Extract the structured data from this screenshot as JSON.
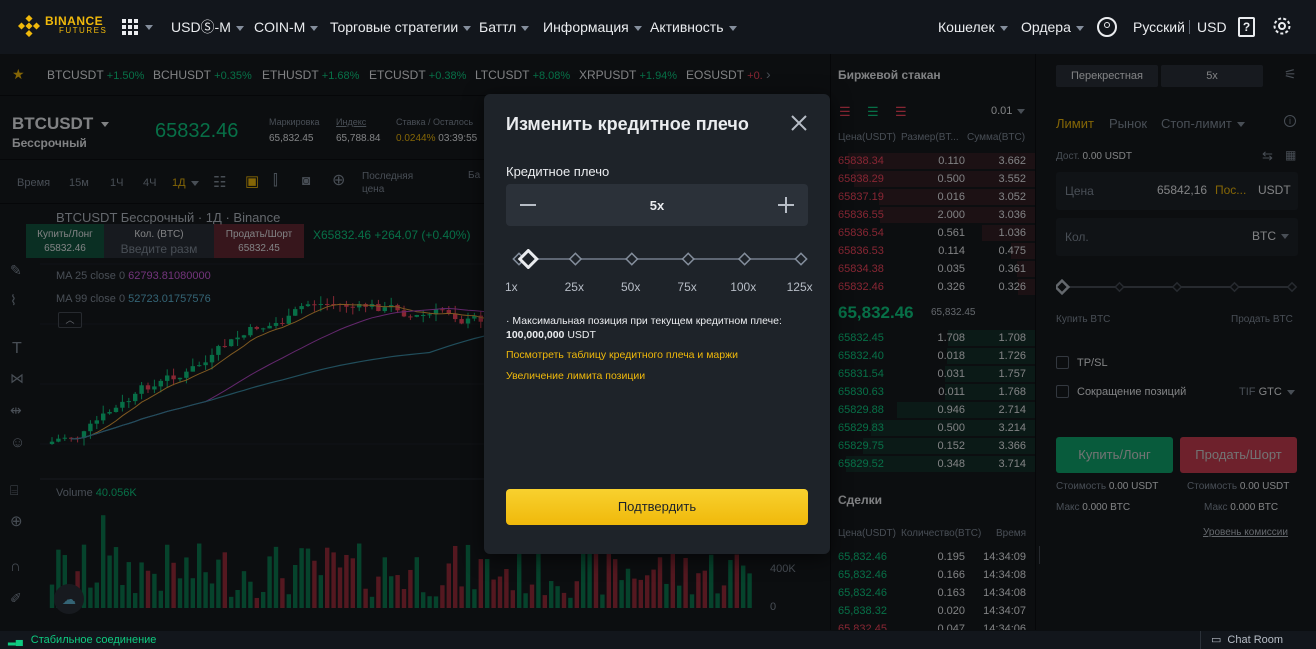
{
  "nav": {
    "brand_top": "BINANCE",
    "brand_bottom": "FUTURES",
    "items": [
      "USDⓈ-M",
      "COIN-M",
      "Торговые стратегии",
      "Баттл",
      "Информация",
      "Активность"
    ],
    "right_items": [
      "Кошелек",
      "Ордера"
    ],
    "language": "Русский",
    "currency": "USD"
  },
  "ticker": [
    {
      "sym": "BTCUSDT",
      "chg": "+1.50%"
    },
    {
      "sym": "BCHUSDT",
      "chg": "+0.35%"
    },
    {
      "sym": "ETHUSDT",
      "chg": "+1.68%"
    },
    {
      "sym": "ETCUSDT",
      "chg": "+0.38%"
    },
    {
      "sym": "LTCUSDT",
      "chg": "+8.08%"
    },
    {
      "sym": "XRPUSDT",
      "chg": "+1.94%"
    },
    {
      "sym": "EOSUSDT",
      "chg": "+0."
    }
  ],
  "symbol": {
    "name": "BTCUSDT",
    "type": "Бессрочный",
    "price": "65832.46",
    "mark_label": "Маркировка",
    "mark_value": "65,832.45",
    "index_label": "Индекс",
    "index_value": "65,788.84",
    "funding_label": "Ставка / Осталось",
    "funding_rate": "0.0244%",
    "funding_time": "03:39:55"
  },
  "chart_toolbar": {
    "time_label": "Время",
    "intervals": [
      "15м",
      "1Ч",
      "4Ч",
      "1Д"
    ],
    "last_price": "Последняя цена",
    "base_label": "Ба"
  },
  "chart": {
    "title": "BTCUSDT Бессрочный · 1Д · Binance",
    "ohlc_suffix": "Х65832.46 +264.07 (+0.40%)",
    "buy_long": "Купить/Лонг",
    "buy_price": "65832.46",
    "qty_label": "Кол. (BTC)",
    "qty_placeholder": "Введите разм",
    "sell_short": "Продать/Шорт",
    "sell_price": "65832.45",
    "ma25": "MA 25 close 0",
    "ma25_val": "62793.81080000",
    "ma99": "MA 99 close 0",
    "ma99_val": "52723.01757576",
    "volume_label": "Volume",
    "volume_val": "40.056K",
    "axis_400k": "400K",
    "axis_0": "0"
  },
  "orderbook": {
    "title": "Биржевой стакан",
    "precision": "0.01",
    "col_price": "Цена(USDT)",
    "col_size": "Размер(BT...",
    "col_sum": "Сумма(BTC)",
    "asks": [
      [
        "65838.34",
        "0.110",
        "3.662"
      ],
      [
        "65838.29",
        "0.500",
        "3.552"
      ],
      [
        "65837.19",
        "0.016",
        "3.052"
      ],
      [
        "65836.55",
        "2.000",
        "3.036"
      ],
      [
        "65836.54",
        "0.561",
        "1.036"
      ],
      [
        "65836.53",
        "0.114",
        "0.475"
      ],
      [
        "65834.38",
        "0.035",
        "0.361"
      ],
      [
        "65832.46",
        "0.326",
        "0.326"
      ]
    ],
    "last_price": "65,832.46",
    "mark_price": "65,832.45",
    "bids": [
      [
        "65832.45",
        "1.708",
        "1.708"
      ],
      [
        "65832.40",
        "0.018",
        "1.726"
      ],
      [
        "65831.54",
        "0.031",
        "1.757"
      ],
      [
        "65830.63",
        "0.011",
        "1.768"
      ],
      [
        "65829.88",
        "0.946",
        "2.714"
      ],
      [
        "65829.83",
        "0.500",
        "3.214"
      ],
      [
        "65829.75",
        "0.152",
        "3.366"
      ],
      [
        "65829.52",
        "0.348",
        "3.714"
      ]
    ],
    "trades_title": "Сделки",
    "trades_col_price": "Цена(USDT)",
    "trades_col_qty": "Количество(BTC)",
    "trades_col_time": "Время",
    "trades": [
      [
        "65,832.46",
        "0.195",
        "14:34:09"
      ],
      [
        "65,832.46",
        "0.166",
        "14:34:08"
      ],
      [
        "65,832.46",
        "0.163",
        "14:34:08"
      ],
      [
        "65,838.32",
        "0.020",
        "14:34:07"
      ],
      [
        "65,832.45",
        "0.047",
        "14:34:06"
      ]
    ]
  },
  "trade": {
    "margin_mode": "Перекрестная",
    "leverage": "5x",
    "tabs": [
      "Лимит",
      "Рынок",
      "Стоп-лимит"
    ],
    "available_label": "Дост.",
    "available_value": "0.00 USDT",
    "price_label": "Цена",
    "price_value": "65842,16",
    "price_suffix": "Пос...",
    "price_unit": "USDT",
    "qty_label": "Кол.",
    "qty_unit": "BTC",
    "buy_label": "Купить BTC",
    "sell_label": "Продать BTC",
    "tpsl": "TP/SL",
    "reduce": "Сокращение позиций",
    "tif": "TIF",
    "tif_value": "GTC",
    "buy_button": "Купить/Лонг",
    "sell_button": "Продать/Шорт",
    "cost_label": "Стоимость",
    "cost_buy": "0.00 USDT",
    "cost_sell": "0.00 USDT",
    "max_label": "Макс",
    "max_buy": "0.000 BTC",
    "max_sell": "0.000 BTC",
    "fee_link": "Уровень комиссии"
  },
  "status": {
    "connection": "Стабильное соединение",
    "chat": "Chat Room"
  },
  "modal": {
    "title": "Изменить кредитное плечо",
    "leverage_label": "Кредитное плечо",
    "leverage_value": "5x",
    "slider_marks": [
      "1x",
      "25x",
      "50x",
      "75x",
      "100x",
      "125x"
    ],
    "slider_level": 0.033,
    "info_line": "· Максимальная позиция при текущем кредитном плече:",
    "info_value": "100,000,000",
    "info_unit": "USDT",
    "link1": "Посмотреть таблицу кредитного плеча и маржи",
    "link2": "Увеличение лимита позиции",
    "confirm": "Подтвердить"
  },
  "colors": {
    "accent": "#f0b90b",
    "up": "#0ecb81",
    "down": "#f6465d",
    "bg": "#161a1e",
    "panel": "#1e2329"
  }
}
